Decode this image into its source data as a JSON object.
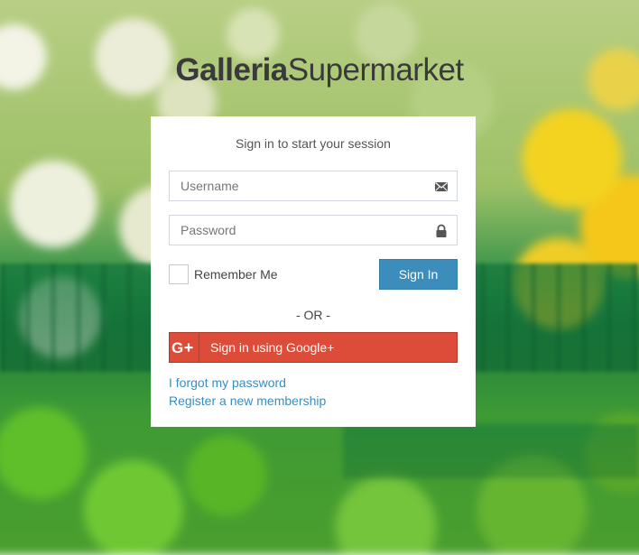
{
  "brand": {
    "bold": "Galleria",
    "light": "Supermarket"
  },
  "login": {
    "message": "Sign in to start your session",
    "username_placeholder": "Username",
    "username_icon": "envelope-icon",
    "password_placeholder": "Password",
    "password_icon": "lock-icon",
    "remember_label": "Remember Me",
    "remember_checked": false,
    "signin_label": "Sign In",
    "or_text": "- OR -",
    "google_label": "Sign in using Google+",
    "google_icon": "google-plus-icon",
    "forgot_link": "I forgot my password",
    "register_link": "Register a new membership"
  },
  "colors": {
    "primary": "#3c8dbc",
    "google": "#dd4b39",
    "brand_text": "#3a3a3a"
  }
}
